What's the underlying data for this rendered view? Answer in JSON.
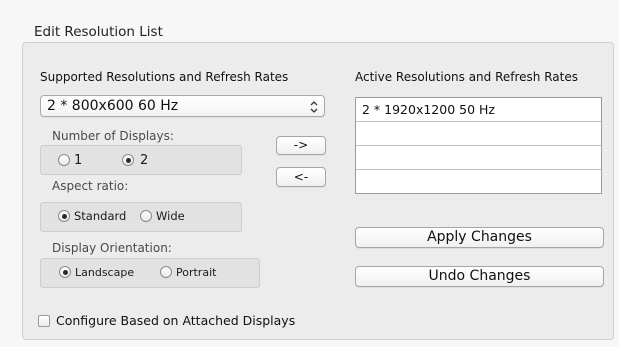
{
  "group": {
    "title": "Edit Resolution List"
  },
  "supported": {
    "label": "Supported Resolutions and Refresh Rates",
    "selected": "2 * 800x600 60 Hz",
    "stepper_icon": "updown-arrows-icon"
  },
  "num_displays": {
    "label": "Number of Displays:",
    "options": [
      {
        "label": "1",
        "selected": false
      },
      {
        "label": "2",
        "selected": true
      }
    ]
  },
  "aspect_ratio": {
    "label": "Aspect ratio:",
    "options": [
      {
        "label": "Standard",
        "selected": true
      },
      {
        "label": "Wide",
        "selected": false
      }
    ]
  },
  "orientation": {
    "label": "Display Orientation:",
    "options": [
      {
        "label": "Landscape",
        "selected": true
      },
      {
        "label": "Portrait",
        "selected": false
      }
    ]
  },
  "transfer": {
    "add_label": "->",
    "remove_label": "<-"
  },
  "active": {
    "label": "Active Resolutions and Refresh Rates",
    "rows": [
      "2 * 1920x1200 50 Hz"
    ]
  },
  "actions": {
    "apply_label": "Apply Changes",
    "undo_label": "Undo Changes"
  },
  "configure": {
    "label": "Configure Based on Attached Displays",
    "checked": false
  }
}
